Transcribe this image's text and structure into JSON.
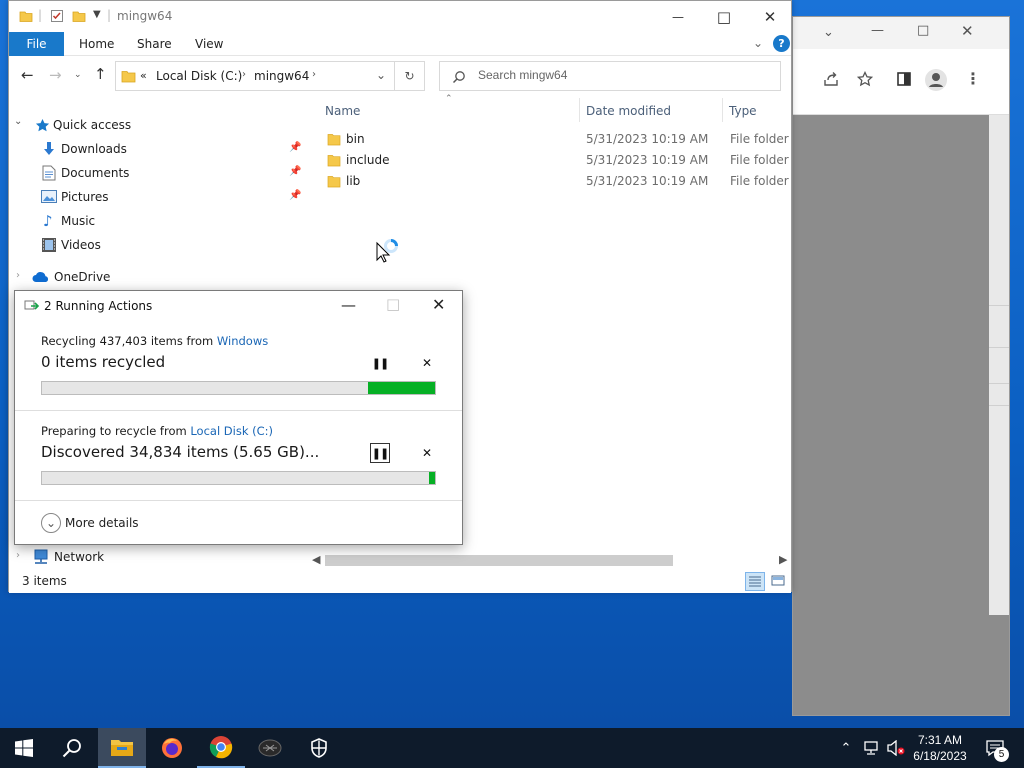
{
  "explorer": {
    "title": "mingw64",
    "ribbon_tabs": [
      "File",
      "Home",
      "Share",
      "View"
    ],
    "address": {
      "root": "Local Disk (C:)",
      "folder": "mingw64"
    },
    "search_placeholder": "Search mingw64",
    "nav": {
      "quick_access": "Quick access",
      "downloads": "Downloads",
      "documents": "Documents",
      "pictures": "Pictures",
      "music": "Music",
      "videos": "Videos",
      "onedrive": "OneDrive",
      "network": "Network"
    },
    "columns": {
      "name": "Name",
      "date": "Date modified",
      "type": "Type"
    },
    "files": [
      {
        "name": "bin",
        "date": "5/31/2023 10:19 AM",
        "type": "File folder"
      },
      {
        "name": "include",
        "date": "5/31/2023 10:19 AM",
        "type": "File folder"
      },
      {
        "name": "lib",
        "date": "5/31/2023 10:19 AM",
        "type": "File folder"
      }
    ],
    "status": "3 items"
  },
  "dialog": {
    "title": "2 Running Actions",
    "op1": {
      "prefix": "Recycling 437,403 items from ",
      "source": "Windows",
      "status": "0 items recycled",
      "progress": 0.17
    },
    "op2": {
      "prefix": "Preparing to recycle from ",
      "source": "Local Disk (C:)",
      "status": "Discovered 34,834 items (5.65 GB)...",
      "progress": 0.015
    },
    "more_details": "More details"
  },
  "taskbar": {
    "time": "7:31 AM",
    "date": "6/18/2023",
    "notification_count": "5"
  },
  "colors": {
    "accent": "#1979ca",
    "progress": "#06b025",
    "taskbar": "#0e1b2b"
  }
}
